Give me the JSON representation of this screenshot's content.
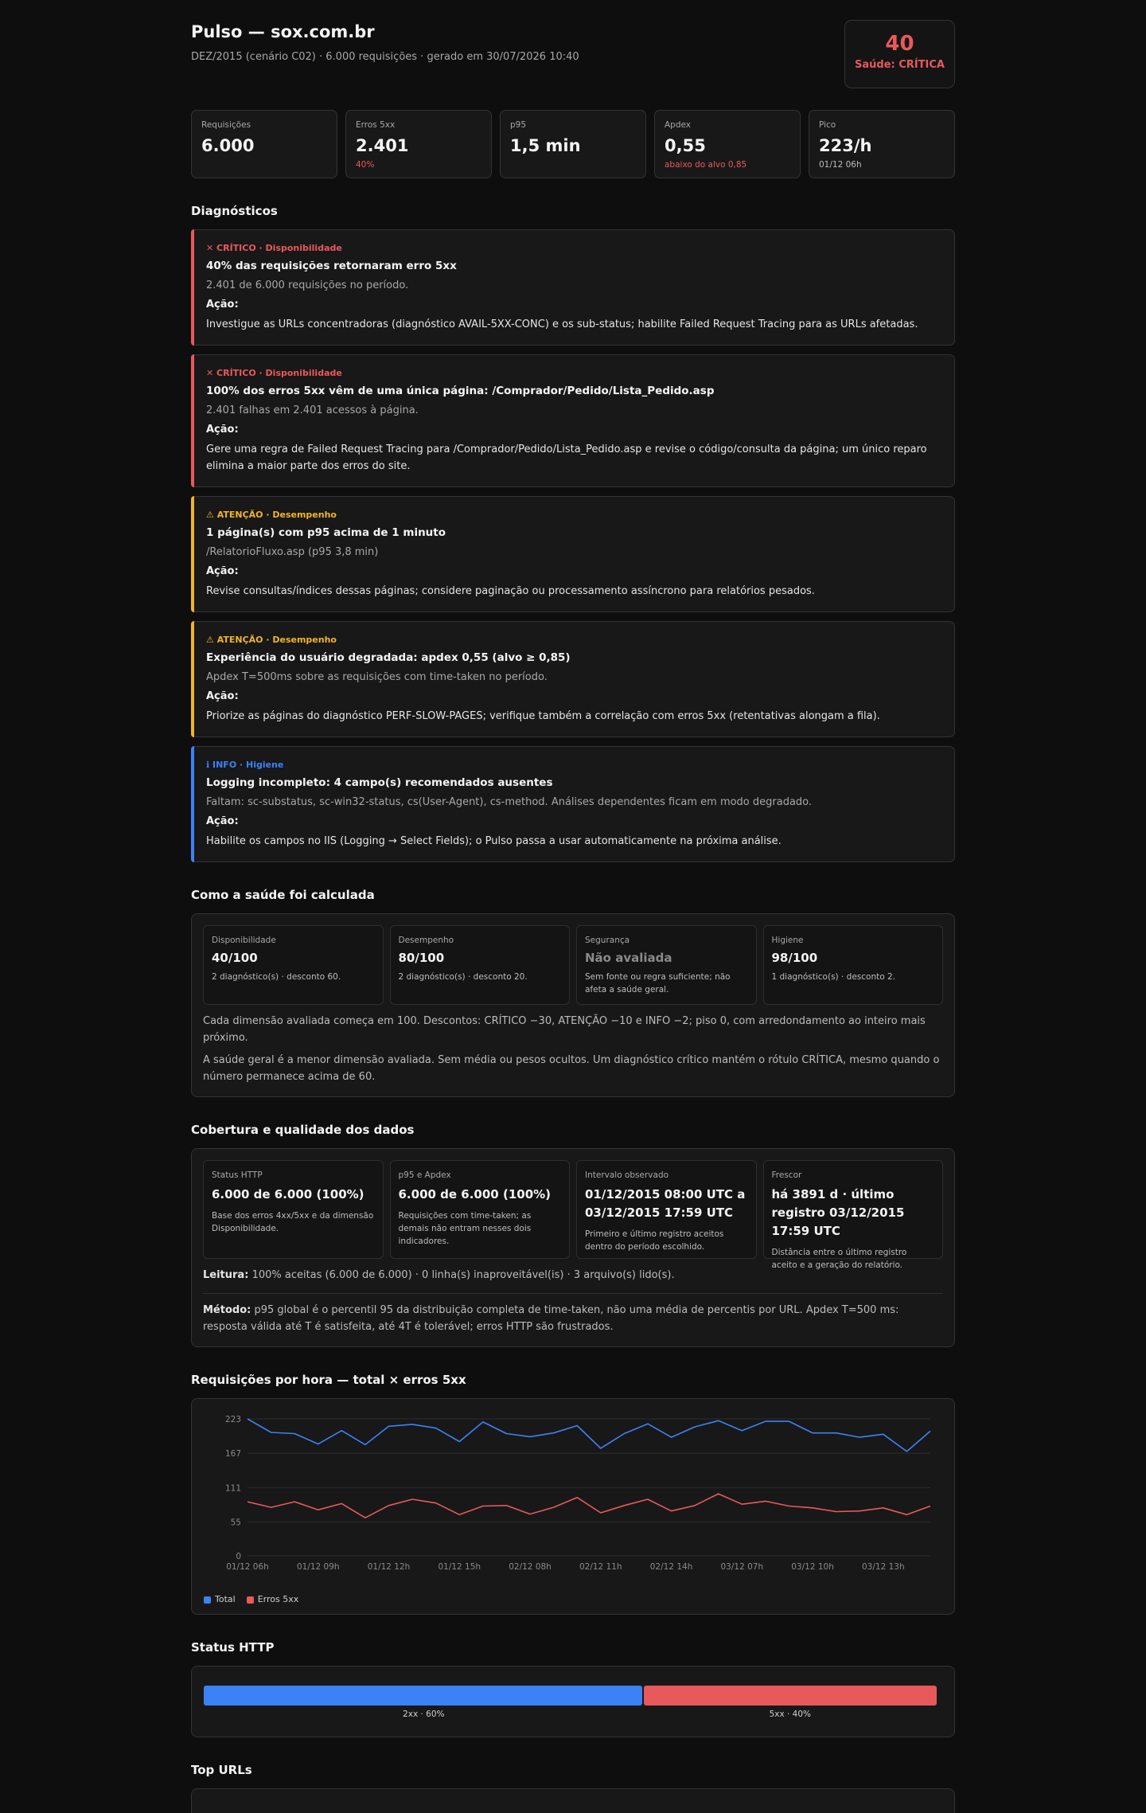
{
  "header": {
    "title": "Pulso — sox.com.br",
    "subtitle": "DEZ/2015 (cenário C02) · 6.000 requisições · gerado em 30/07/2026 10:40",
    "health_score": "40",
    "health_label": "Saúde: CRÍTICA"
  },
  "kpis": [
    {
      "label": "Requisições",
      "value": "6.000",
      "sub": ""
    },
    {
      "label": "Erros 5xx",
      "value": "2.401",
      "sub": "40%"
    },
    {
      "label": "p95",
      "value": "1,5 min",
      "sub": ""
    },
    {
      "label": "Apdex",
      "value": "0,55",
      "sub": "abaixo do alvo 0,85"
    },
    {
      "label": "Pico",
      "value": "223/h",
      "sub": "01/12 06h"
    }
  ],
  "diagnostics": {
    "heading": "Diagnósticos",
    "action_label": "Ação:",
    "items": [
      {
        "tag": "✕ CRÍTICO · Disponibilidade",
        "title": "40% das requisições retornaram erro 5xx",
        "detail": "2.401 de 6.000 requisições no período.",
        "action": "Investigue as URLs concentradoras (diagnóstico AVAIL-5XX-CONC) e os sub-status; habilite Failed Request Tracing para as URLs afetadas.",
        "color": "#e8595c"
      },
      {
        "tag": "✕ CRÍTICO · Disponibilidade",
        "title": "100% dos erros 5xx vêm de uma única página: /Comprador/Pedido/Lista_Pedido.asp",
        "detail": "2.401 falhas em 2.401 acessos à página.",
        "action": "Gere uma regra de Failed Request Tracing para /Comprador/Pedido/Lista_Pedido.asp e revise o código/consulta da página; um único reparo elimina a maior parte dos erros do site.",
        "color": "#e8595c"
      },
      {
        "tag": "⚠ ATENÇÃO · Desempenho",
        "title": "1 página(s) com p95 acima de 1 minuto",
        "detail": "/RelatorioFluxo.asp (p95 3,8 min)",
        "action": "Revise consultas/índices dessas páginas; considere paginação ou processamento assíncrono para relatórios pesados.",
        "color": "#f0b429"
      },
      {
        "tag": "⚠ ATENÇÃO · Desempenho",
        "title": "Experiência do usuário degradada: apdex 0,55 (alvo ≥ 0,85)",
        "detail": "Apdex T=500ms sobre as requisições com time-taken no período.",
        "action": "Priorize as páginas do diagnóstico PERF-SLOW-PAGES; verifique também a correlação com erros 5xx (retentativas alongam a fila).",
        "color": "#f0b429"
      },
      {
        "tag": "ℹ INFO · Higiene",
        "title": "Logging incompleto: 4 campo(s) recomendados ausentes",
        "detail": "Faltam: sc-substatus, sc-win32-status, cs(User-Agent), cs-method. Análises dependentes ficam em modo degradado.",
        "action": "Habilite os campos no IIS (Logging → Select Fields); o Pulso passa a usar automaticamente na próxima análise.",
        "color": "#3b82f6"
      }
    ]
  },
  "health_calc": {
    "heading": "Como a saúde foi calculada",
    "dims": [
      {
        "label": "Disponibilidade",
        "value": "40/100",
        "note": "2 diagnóstico(s) · desconto 60."
      },
      {
        "label": "Desempenho",
        "value": "80/100",
        "note": "2 diagnóstico(s) · desconto 20."
      },
      {
        "label": "Segurança",
        "value": "Não avaliada",
        "note": "Sem fonte ou regra suficiente; não afeta a saúde geral."
      },
      {
        "label": "Higiene",
        "value": "98/100",
        "note": "1 diagnóstico(s) · desconto 2."
      }
    ],
    "note1": "Cada dimensão avaliada começa em 100. Descontos: CRÍTICO −30, ATENÇÃO −10 e INFO −2; piso 0, com arredondamento ao inteiro mais próximo.",
    "note2": "A saúde geral é a menor dimensão avaliada. Sem média ou pesos ocultos. Um diagnóstico crítico mantém o rótulo CRÍTICA, mesmo quando o número permanece acima de 60."
  },
  "coverage": {
    "heading": "Cobertura e qualidade dos dados",
    "cards": [
      {
        "label": "Status HTTP",
        "value": "6.000 de 6.000 (100%)",
        "note": "Base dos erros 4xx/5xx e da dimensão Disponibilidade."
      },
      {
        "label": "p95 e Apdex",
        "value": "6.000 de 6.000 (100%)",
        "note": "Requisições com time-taken; as demais não entram nesses dois indicadores."
      },
      {
        "label": "Intervalo observado",
        "value": "01/12/2015 08:00 UTC a 03/12/2015 17:59 UTC",
        "note": "Primeiro e último registro aceitos dentro do período escolhido."
      },
      {
        "label": "Frescor",
        "value": "há 3891 d · último registro 03/12/2015 17:59 UTC",
        "note": "Distância entre o último registro aceito e a geração do relatório."
      }
    ],
    "reading_label": "Leitura:",
    "reading": "100% aceitas (6.000 de 6.000) · 0 linha(s) inaproveitável(is) · 3 arquivo(s) lido(s).",
    "method_label": "Método:",
    "method": "p95 global é o percentil 95 da distribuição completa de time-taken, não uma média de percentis por URL. Apdex T=500 ms: resposta válida até T é satisfeita, até 4T é tolerável; erros HTTP são frustrados."
  },
  "chart_heading": "Requisições por hora — total × erros 5xx",
  "chart_data": {
    "type": "line",
    "y_ticks": [
      "0",
      "55",
      "111",
      "167",
      "223"
    ],
    "ylim": [
      0,
      223
    ],
    "grid": true,
    "x_tick_labels": [
      "01/12 06h",
      "01/12 09h",
      "01/12 12h",
      "01/12 15h",
      "02/12 08h",
      "02/12 11h",
      "02/12 14h",
      "03/12 07h",
      "03/12 10h",
      "03/12 13h"
    ],
    "legend_placement": "bottom-left",
    "series": [
      {
        "name": "Total",
        "color": "#3b82f6",
        "values": [
          223,
          201,
          199,
          182,
          204,
          181,
          211,
          214,
          208,
          186,
          218,
          199,
          194,
          200,
          212,
          175,
          199,
          215,
          193,
          210,
          220,
          204,
          219,
          219,
          200,
          200,
          193,
          198,
          170,
          203
        ]
      },
      {
        "name": "Erros 5xx",
        "color": "#e8595c",
        "values": [
          88,
          79,
          88,
          75,
          85,
          62,
          82,
          92,
          86,
          67,
          81,
          82,
          68,
          79,
          95,
          70,
          82,
          92,
          73,
          82,
          101,
          84,
          89,
          81,
          78,
          72,
          73,
          78,
          67,
          81
        ]
      }
    ]
  },
  "status_http": {
    "heading": "Status HTTP",
    "segments": [
      {
        "label": "2xx · 60%",
        "value": 60,
        "color": "#3b82f6"
      },
      {
        "label": "5xx · 40%",
        "value": 40,
        "color": "#e8595c"
      }
    ]
  },
  "top_urls": {
    "heading": "Top URLs"
  }
}
